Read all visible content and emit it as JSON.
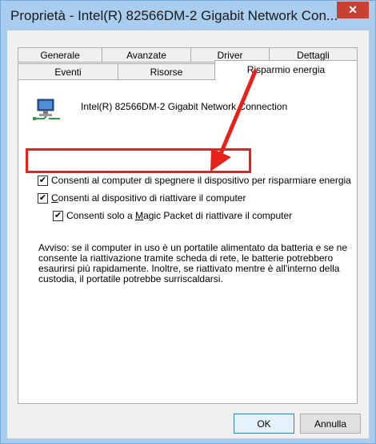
{
  "window": {
    "title": "Proprietà - Intel(R) 82566DM-2 Gigabit Network Con...",
    "close_glyph": "✕"
  },
  "tabs": {
    "row1": [
      "Generale",
      "Avanzate",
      "Driver",
      "Dettagli"
    ],
    "row2": [
      "Eventi",
      "Risorse",
      "Risparmio energia"
    ],
    "active": "Risparmio energia"
  },
  "panel": {
    "device_name": "Intel(R) 82566DM-2 Gigabit Network Connection",
    "device_icon": "network-adapter-icon",
    "checks": [
      {
        "label": "Consenti al computer di spegnere il dispositivo per risparmiare energia",
        "checked": true
      },
      {
        "label_pre": "C",
        "label_rest": "onsenti al dispositivo di riattivare il computer",
        "checked": true
      },
      {
        "label_pre": "Consenti solo a ",
        "label_u": "M",
        "label_rest": "agic Packet di riattivare il computer",
        "checked": true
      }
    ],
    "warning": "Avviso: se il computer in uso è un portatile alimentato da batteria e se ne consente la riattivazione tramite scheda di rete, le batterie potrebbero esaurirsi più rapidamente. Inoltre, se riattivato mentre è all'interno della custodia, il portatile potrebbe surriscaldarsi."
  },
  "buttons": {
    "ok": "OK",
    "cancel": "Annulla"
  },
  "colors": {
    "annotation": "#e8211b",
    "titlebar": "#a9cdee",
    "close": "#c84031"
  }
}
